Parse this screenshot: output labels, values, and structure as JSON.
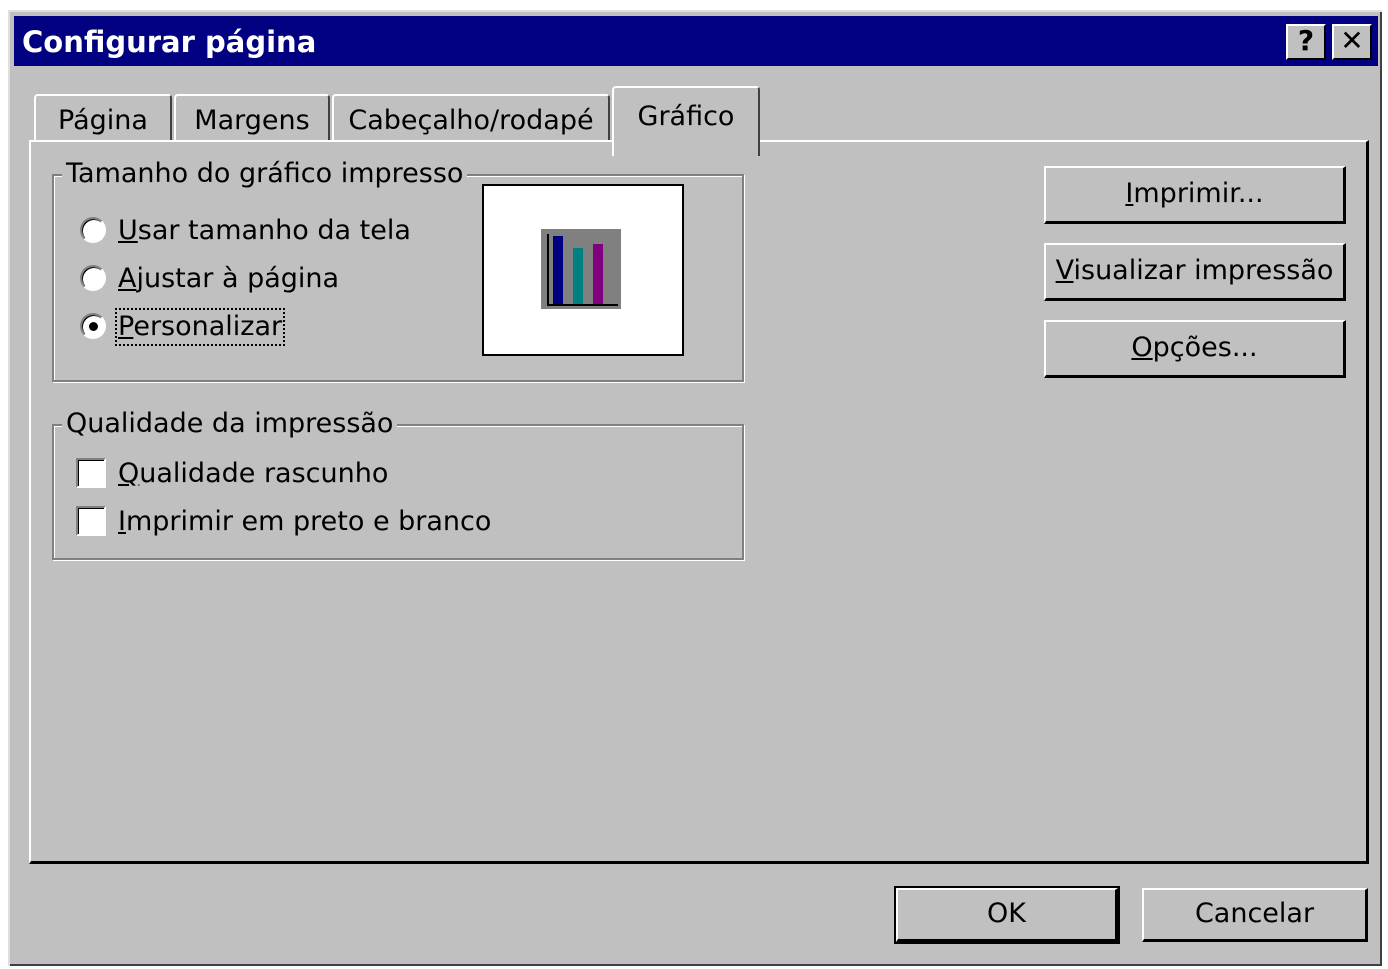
{
  "window": {
    "title": "Configurar página"
  },
  "titlebar_buttons": {
    "help": "?",
    "close": "✕"
  },
  "tabs": [
    {
      "label": "Página"
    },
    {
      "label": "Margens"
    },
    {
      "label": "Cabeçalho/rodapé"
    },
    {
      "label": "Gráfico",
      "active": true
    }
  ],
  "size_group": {
    "legend": "Tamanho do gráfico impresso",
    "options": [
      {
        "label_first": "U",
        "label_rest": "sar tamanho da tela",
        "checked": false
      },
      {
        "label_first": "A",
        "label_rest": "justar à página",
        "checked": false
      },
      {
        "label_first": "P",
        "label_rest": "ersonalizar",
        "checked": true
      }
    ]
  },
  "quality_group": {
    "legend": "Qualidade da impressão",
    "options": [
      {
        "label_first": "Q",
        "label_rest": "ualidade rascunho",
        "checked": false
      },
      {
        "label_first": "I",
        "label_mid": "mp",
        "label_rest": "rimir em preto e branco",
        "checked": false
      }
    ]
  },
  "side_buttons": {
    "print_first": "I",
    "print_rest": "mprimir...",
    "preview_first": "V",
    "preview_rest": "isualizar impressão",
    "options_first": "O",
    "options_rest": "pções..."
  },
  "footer": {
    "ok": "OK",
    "cancel": "Cancelar"
  },
  "colors": {
    "titlebar": "#000080",
    "face": "#c0c0c0",
    "bar1": "#000080",
    "bar2": "#008080",
    "bar3": "#800080"
  }
}
